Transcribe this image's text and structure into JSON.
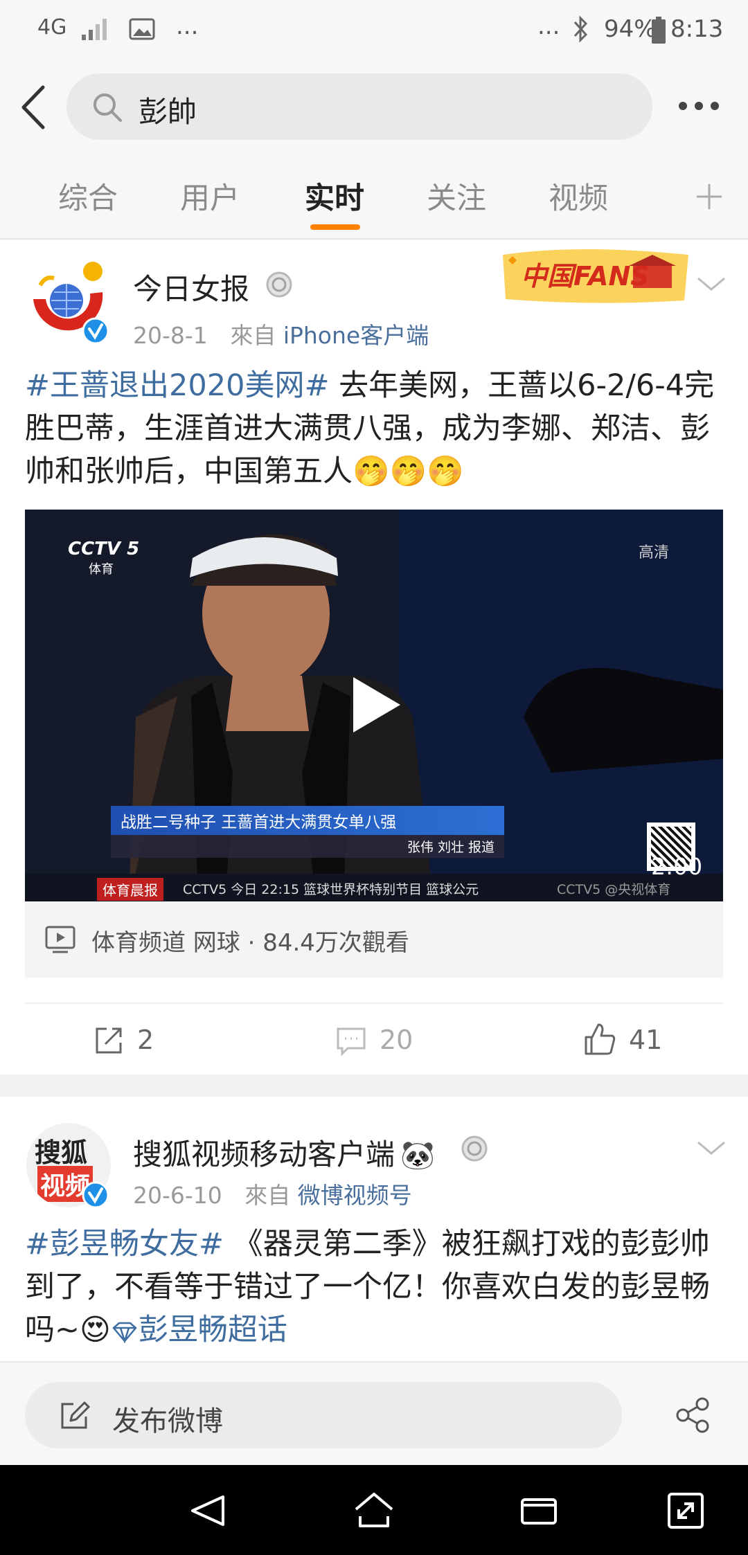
{
  "status_bar": {
    "network": "4G",
    "more": "...",
    "more_right": "...",
    "battery": "94%",
    "time": "8:13"
  },
  "search": {
    "query": "彭帥"
  },
  "tabs": [
    {
      "label": "综合",
      "active": false
    },
    {
      "label": "用户",
      "active": false
    },
    {
      "label": "实时",
      "active": true
    },
    {
      "label": "关注",
      "active": false
    },
    {
      "label": "视频",
      "active": false
    }
  ],
  "posts": [
    {
      "author": "今日女报",
      "date": "20-8-1",
      "source_prefix": "來自",
      "source": "iPhone客户端",
      "badge": "中国FANS",
      "hashtag": "#王蔷退出2020美网#",
      "text": "去年美网，王蔷以6-2/6-4完胜巴蒂，生涯首进大满贯八强，成为李娜、郑洁、彭帅和张帅后，中国第五人",
      "emojis": "🤭🤭🤭",
      "video": {
        "logo_main": "CCTV 5",
        "logo_sub": "体育",
        "hd_label": "高清",
        "caption_title": "战胜二号种子 王蔷首进大满贯女单八强",
        "caption_reporter": "张伟 刘壮 报道",
        "ticker_tag": "体育晨报",
        "ticker_text": "CCTV5 今日 22:15 篮球世界杯特别节目 篮球公元",
        "watermark": "CCTV5 @央视体育",
        "duration": "2:00"
      },
      "video_info": "体育频道 网球 · 84.4万次觀看",
      "reposts": "2",
      "comments": "20",
      "likes": "41"
    },
    {
      "author": "搜狐视频移动客户端",
      "author_emoji": "🐼",
      "avatar_line1": "搜狐",
      "avatar_line2": "视频",
      "date": "20-6-10",
      "source_prefix": "來自",
      "source": "微博视频号",
      "hashtag": "#彭昱畅女友#",
      "text": "《器灵第二季》被狂飙打戏的彭彭帅到了，不看等于错过了一个亿！你喜欢白发的彭昱畅吗~",
      "emoji": "😍",
      "supertopic": "彭昱畅超话"
    }
  ],
  "compose": {
    "label": "发布微博"
  },
  "colors": {
    "accent": "#ff8200",
    "link": "#3f6d9f",
    "verified": "#1e8fe6"
  }
}
